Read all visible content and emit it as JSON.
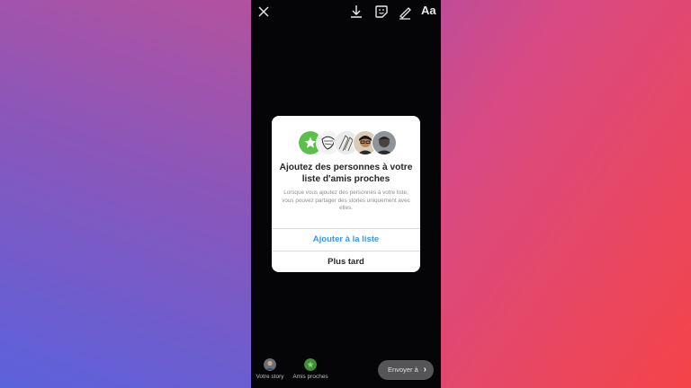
{
  "toolbar": {
    "text_tool_label": "Aa",
    "icons": [
      "close-icon",
      "download-icon",
      "sticker-icon",
      "draw-icon"
    ]
  },
  "dialog": {
    "title": "Ajoutez des personnes à votre liste d'amis proches",
    "description": "Lorsque vous ajoutez des personnes à votre liste, vous pouvez partager des stories uniquement avec elles.",
    "primary_button": "Ajouter à la liste",
    "secondary_button": "Plus tard"
  },
  "bottom_bar": {
    "your_story_label": "Votre story",
    "close_friends_label": "Amis proches",
    "send_label": "Envoyer à"
  },
  "colors": {
    "accent_blue": "#3897f0",
    "close_friends_green": "#5cbf4a",
    "phone_bg": "#050507"
  }
}
